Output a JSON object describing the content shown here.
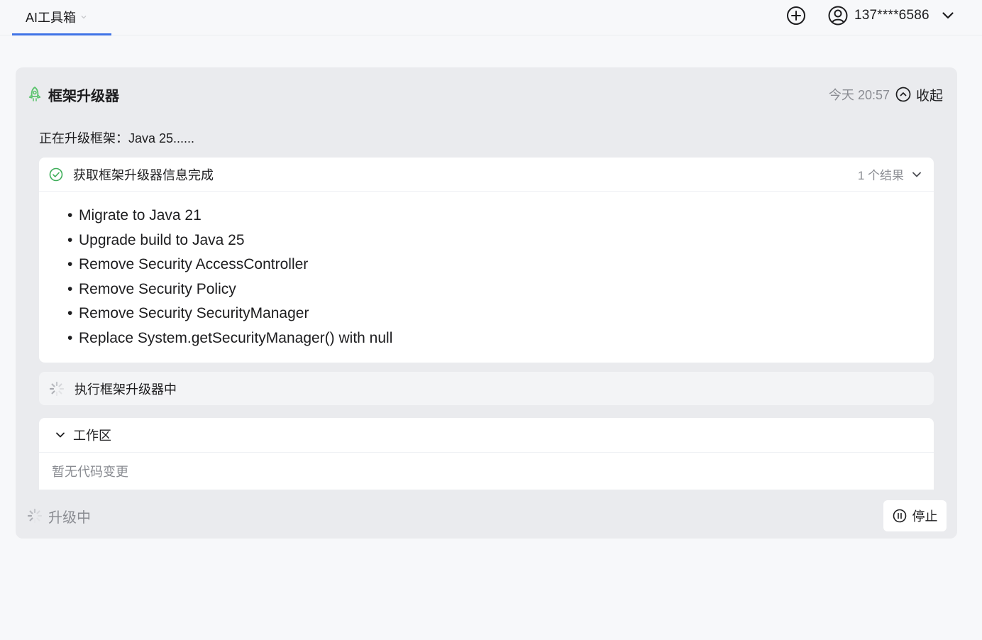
{
  "header": {
    "tab_label": "AI工具箱",
    "user_name": "137****6586"
  },
  "card": {
    "title": "框架升级器",
    "time": "今天 20:57",
    "collapse_label": "收起",
    "status_text": "正在升级框架：Java 25......",
    "info_panel": {
      "label": "获取框架升级器信息完成",
      "result_count": "1 个结果",
      "items": [
        "Migrate to Java 21",
        "Upgrade build to Java 25",
        "Remove Security AccessController",
        "Remove Security Policy",
        "Remove Security SecurityManager",
        "Replace System.getSecurityManager() with null"
      ]
    },
    "exec_panel": {
      "label": "执行框架升级器中"
    },
    "workspace": {
      "label": "工作区",
      "empty_text": "暂无代码变更"
    },
    "footer": {
      "status": "升级中",
      "stop_label": "停止"
    }
  },
  "colors": {
    "accent": "#3f73e6",
    "success": "#3fae5a",
    "muted": "#8a8c92",
    "card_bg": "#eaebee"
  },
  "icons": {
    "plus": "plus-circle-icon",
    "user": "user-circle-icon",
    "chevron": "chevron-down-icon",
    "title": "rocket-icon",
    "collapse": "chevron-up-circle-icon",
    "success": "check-circle-icon",
    "loading": "spinner-icon",
    "stop": "pause-circle-icon"
  }
}
